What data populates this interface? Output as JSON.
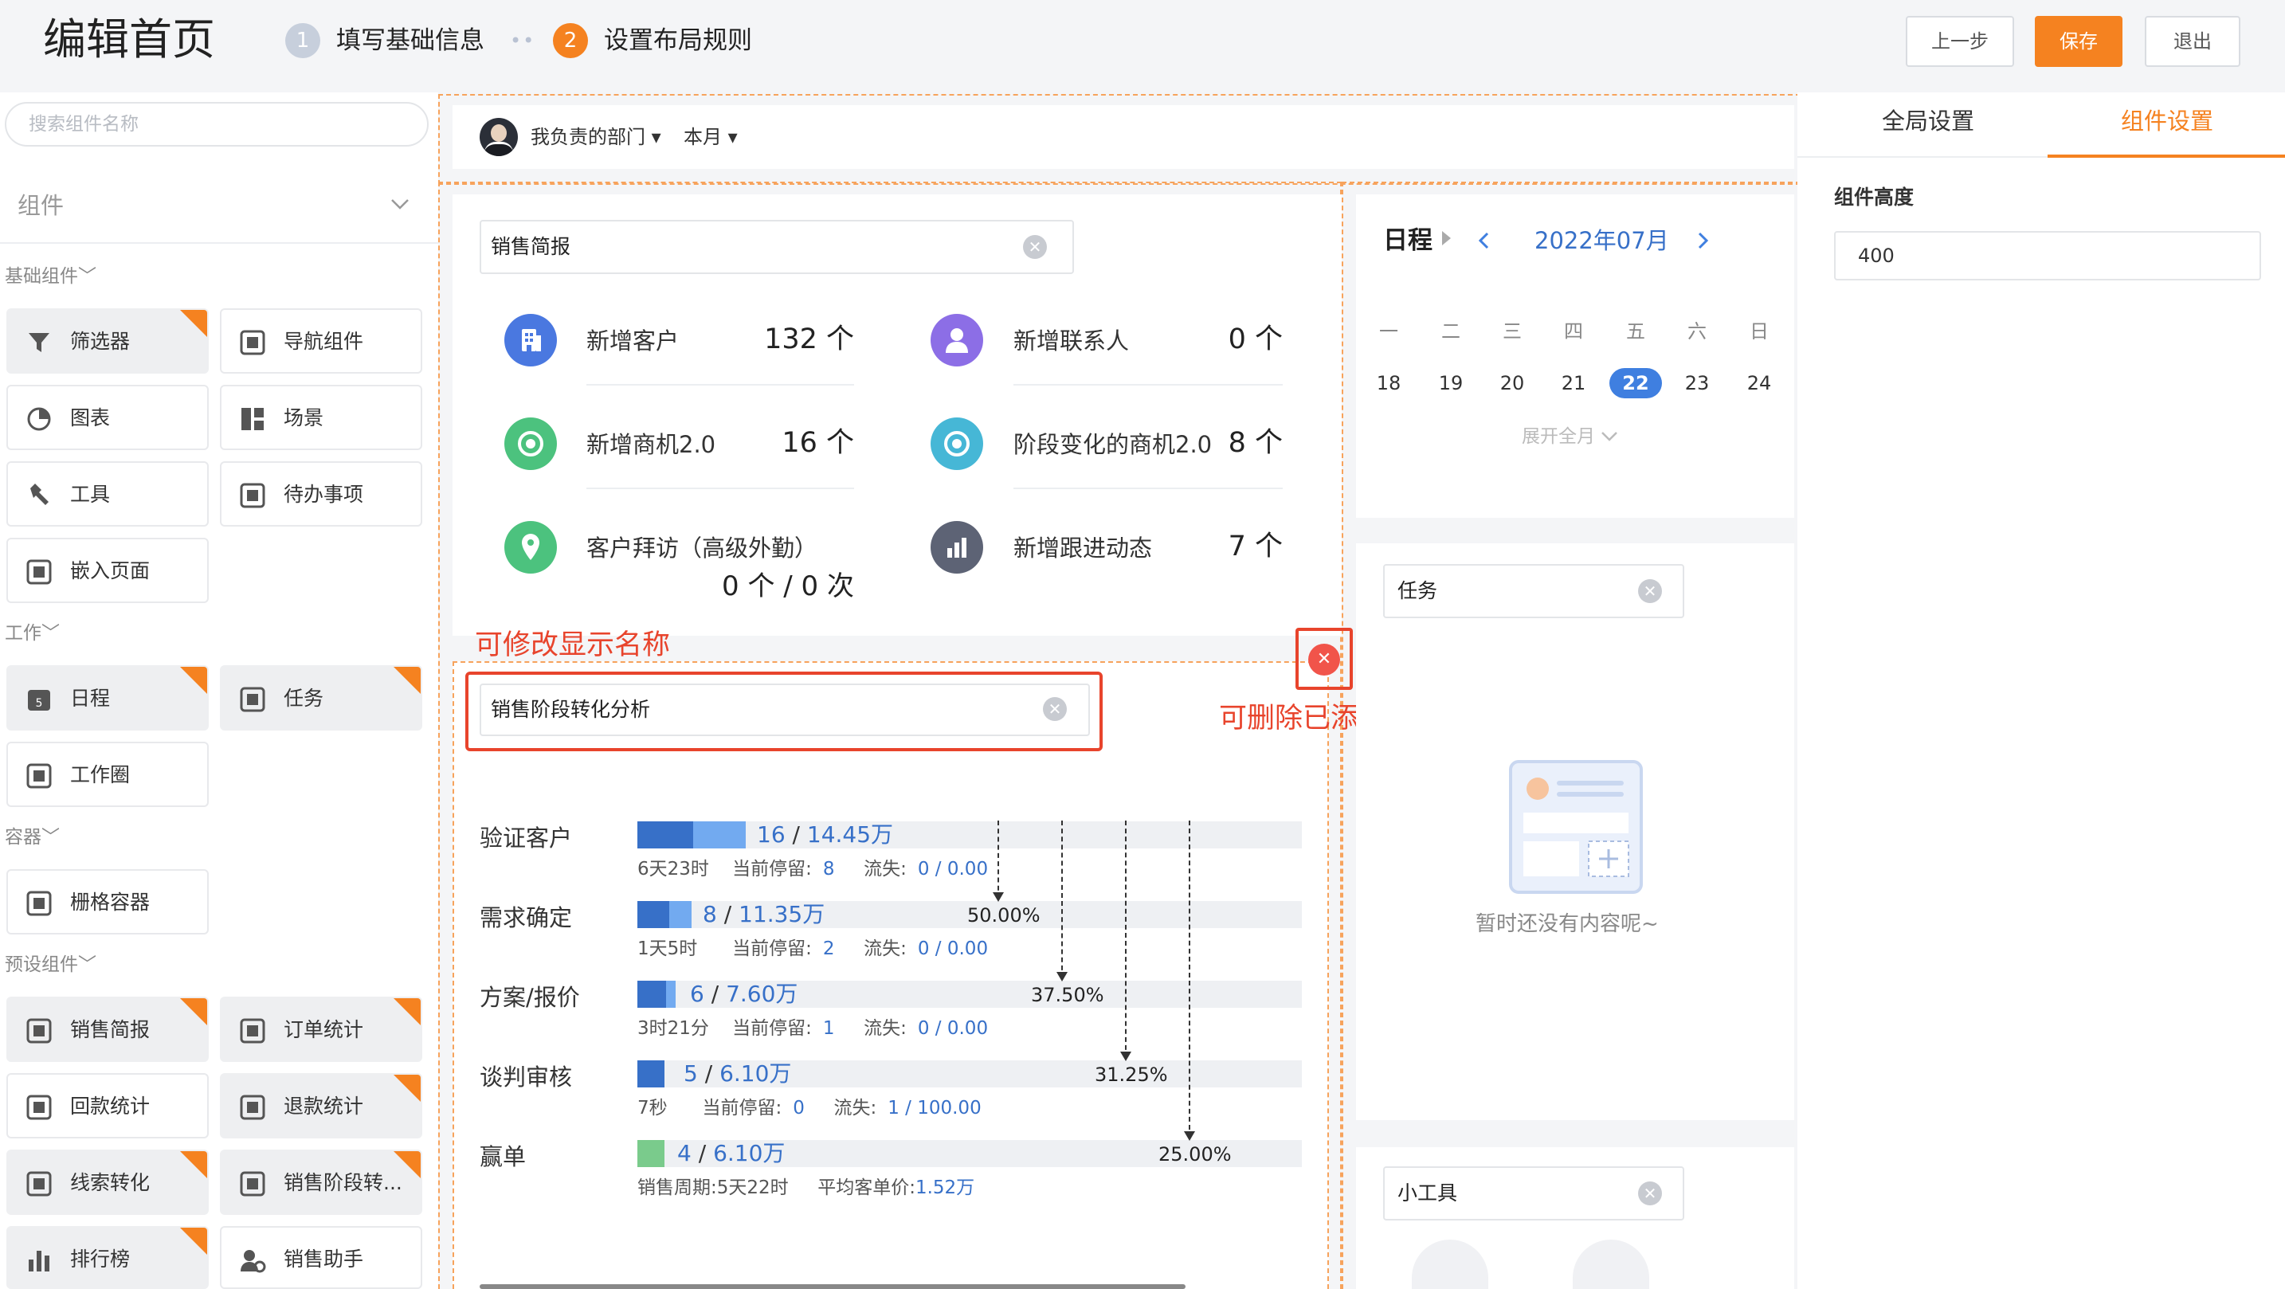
{
  "header": {
    "title": "编辑首页",
    "steps": [
      {
        "number": "1",
        "label": "填写基础信息"
      },
      {
        "number": "2",
        "label": "设置布局规则"
      }
    ],
    "step_dots": "••",
    "buttons": {
      "prev": "上一步",
      "save": "保存",
      "exit": "退出"
    }
  },
  "sidebar": {
    "search_placeholder": "搜索组件名称",
    "section_title": "组件",
    "groups": [
      {
        "title": "基础组件",
        "items": [
          "筛选器",
          "导航组件",
          "图表",
          "场景",
          "工具",
          "待办事项",
          "嵌入页面"
        ]
      },
      {
        "title": "工作",
        "items": [
          "日程",
          "任务",
          "工作圈"
        ]
      },
      {
        "title": "容器",
        "items": [
          "栅格容器"
        ]
      },
      {
        "title": "预设组件",
        "items": [
          "销售简报",
          "订单统计",
          "回款统计",
          "退款统计",
          "线索转化",
          "销售阶段转...",
          "排行榜",
          "销售助手"
        ]
      }
    ]
  },
  "filter_bar": {
    "department": "我负责的部门",
    "period": "本月"
  },
  "sales_report": {
    "name": "销售简报",
    "stats": [
      {
        "label": "新增客户",
        "value": "132 个",
        "color": "#4a78e0",
        "icon": "building-icon"
      },
      {
        "label": "新增联系人",
        "value": "0 个",
        "color": "#8c6ee6",
        "icon": "person-icon"
      },
      {
        "label": "新增商机2.0",
        "value": "16 个",
        "color": "#4cc27e",
        "icon": "target-icon"
      },
      {
        "label": "阶段变化的商机2.0",
        "value": "8 个",
        "color": "#46b7d6",
        "icon": "target-icon"
      },
      {
        "label": "客户拜访（高级外勤）",
        "value": "0 个  /  0 次",
        "color": "#4cc27e",
        "icon": "location-icon"
      },
      {
        "label": "新增跟进动态",
        "value": "7 个",
        "color": "#5d6375",
        "icon": "bar-chart-icon"
      }
    ]
  },
  "annotations": {
    "rename": "可修改显示名称",
    "delete": "可删除已添加的组件"
  },
  "funnel": {
    "name": "销售阶段转化分析",
    "stages": [
      {
        "label": "验证客户",
        "count": "16",
        "amount": "14.45万",
        "duration": "6天23时",
        "stay_label": "当前停留:",
        "stay": "8",
        "loss_label": "流失:",
        "loss": "0 / 0.00"
      },
      {
        "label": "需求确定",
        "count": "8",
        "amount": "11.35万",
        "duration": "1天5时",
        "stay_label": "当前停留:",
        "stay": "2",
        "loss_label": "流失:",
        "loss": "0 / 0.00"
      },
      {
        "label": "方案/报价",
        "count": "6",
        "amount": "7.60万",
        "duration": "3时21分",
        "stay_label": "当前停留:",
        "stay": "1",
        "loss_label": "流失:",
        "loss": "0 / 0.00"
      },
      {
        "label": "谈判审核",
        "count": "5",
        "amount": "6.10万",
        "duration": "7秒",
        "stay_label": "当前停留:",
        "stay": "0",
        "loss_label": "流失:",
        "loss": "1 / 100.00"
      },
      {
        "label": "赢单",
        "count": "4",
        "amount": "6.10万",
        "cycle": "销售周期:5天22时",
        "avg_label": "平均客单价:",
        "avg": "1.52万"
      }
    ],
    "conversion_rates": [
      "50.00%",
      "37.50%",
      "31.25%",
      "25.00%"
    ]
  },
  "schedule": {
    "title": "日程",
    "month": "2022年07月",
    "weekdays": [
      "一",
      "二",
      "三",
      "四",
      "五",
      "六",
      "日"
    ],
    "days": [
      "18",
      "19",
      "20",
      "21",
      "22",
      "23",
      "24"
    ],
    "today": "22",
    "expand": "展开全月"
  },
  "task": {
    "name": "任务",
    "empty_text": "暂时还没有内容呢~"
  },
  "widget": {
    "name": "小工具"
  },
  "right_panel": {
    "tabs": [
      "全局设置",
      "组件设置"
    ],
    "height_label": "组件高度",
    "height_value": "400"
  },
  "colors": {
    "accent": "#f58220",
    "blue": "#3770c8",
    "red": "#e8442c"
  }
}
